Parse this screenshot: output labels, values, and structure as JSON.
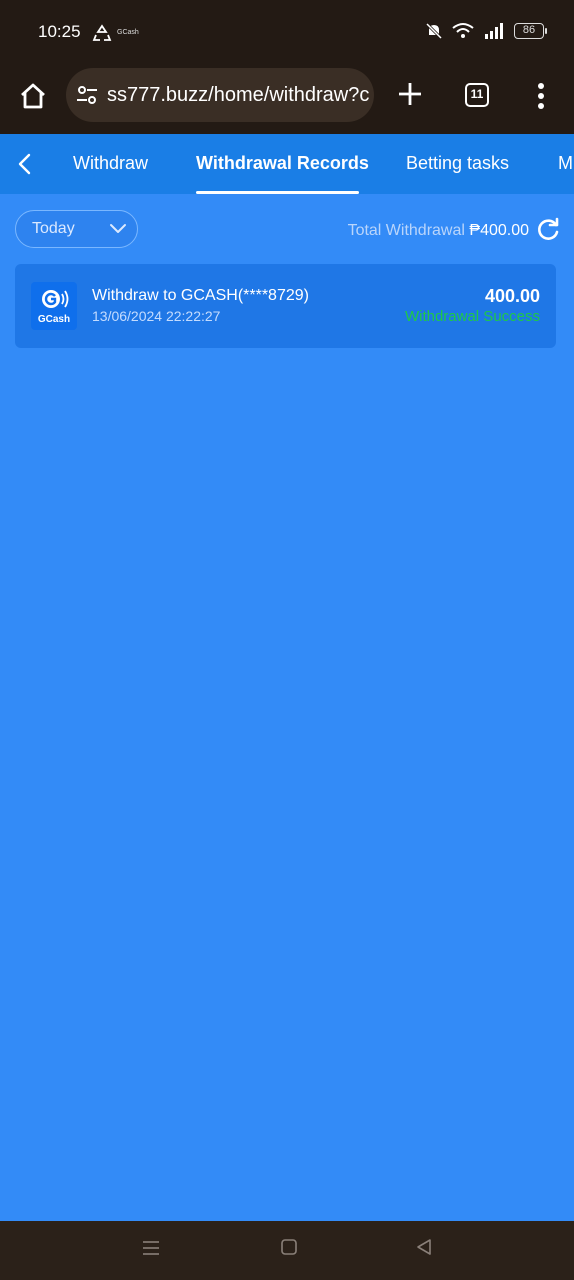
{
  "status_bar": {
    "time": "10:25",
    "app_label": "GCash",
    "battery": "86"
  },
  "browser": {
    "url": "ss777.buzz/home/withdraw?c",
    "tab_count": "11"
  },
  "nav": {
    "tabs": [
      {
        "label": "Withdraw",
        "active": false
      },
      {
        "label": "Withdrawal Records",
        "active": true
      },
      {
        "label": "Betting tasks",
        "active": false
      },
      {
        "label": "M",
        "active": false
      }
    ]
  },
  "filter": {
    "selected": "Today"
  },
  "summary": {
    "label": "Total Withdrawal",
    "amount": "₱400.00"
  },
  "records": [
    {
      "method_logo_text": "GCash",
      "title": "Withdraw to GCASH(****8729)",
      "datetime": "13/06/2024 22:22:27",
      "amount": "400.00",
      "status": "Withdrawal Success"
    }
  ],
  "colors": {
    "background": "#338bf7",
    "header": "#1a7ee6",
    "card": "#1f77e6",
    "success": "#1fc84a"
  }
}
